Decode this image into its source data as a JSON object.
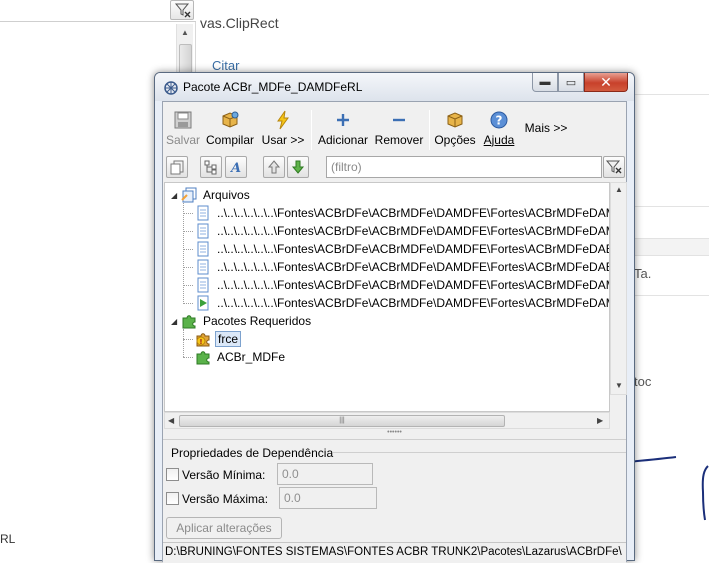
{
  "background": {
    "clip_text": "vas.ClipRect",
    "citar": "Citar",
    "ta_text": "Ta.",
    "toc_text": "toc",
    "rl_text": "RL"
  },
  "window": {
    "title": "Pacote ACBr_MDFe_DAMDFeRL",
    "toolbar": {
      "salvar": "Salvar",
      "compilar": "Compilar",
      "usar": "Usar >>",
      "adicionar": "Adicionar",
      "remover": "Remover",
      "opcoes": "Opções",
      "ajuda": "Ajuda",
      "mais": "Mais >>"
    },
    "filter_placeholder": "(filtro)",
    "tree": {
      "arquivos_label": "Arquivos",
      "files": [
        "..\\..\\..\\..\\..\\..\\Fontes\\ACBrDFe\\ACBrMDFe\\DAMDFE\\Fortes\\ACBrMDFeDAM",
        "..\\..\\..\\..\\..\\..\\Fontes\\ACBrDFe\\ACBrMDFe\\DAMDFE\\Fortes\\ACBrMDFeDAM",
        "..\\..\\..\\..\\..\\..\\Fontes\\ACBrDFe\\ACBrMDFe\\DAMDFE\\Fortes\\ACBrMDFeDAE",
        "..\\..\\..\\..\\..\\..\\Fontes\\ACBrDFe\\ACBrMDFe\\DAMDFE\\Fortes\\ACBrMDFeDAE",
        "..\\..\\..\\..\\..\\..\\Fontes\\ACBrDFe\\ACBrMDFe\\DAMDFE\\Fortes\\ACBrMDFeDAM",
        "..\\..\\..\\..\\..\\..\\Fontes\\ACBrDFe\\ACBrMDFe\\DAMDFE\\Fortes\\ACBrMDFeDAM"
      ],
      "pacotes_label": "Pacotes Requeridos",
      "packages": [
        "frce",
        "ACBr_MDFe"
      ]
    },
    "properties": {
      "title": "Propriedades de Dependência",
      "min_label": "Versão Mínima:",
      "min_value": "0.0",
      "max_label": "Versão Máxima:",
      "max_value": "0.0",
      "apply_label": "Aplicar alterações"
    },
    "status_path": "D:\\BRUNING\\FONTES SISTEMAS\\FONTES ACBR TRUNK2\\Pacotes\\Lazarus\\ACBrDFe\\"
  }
}
